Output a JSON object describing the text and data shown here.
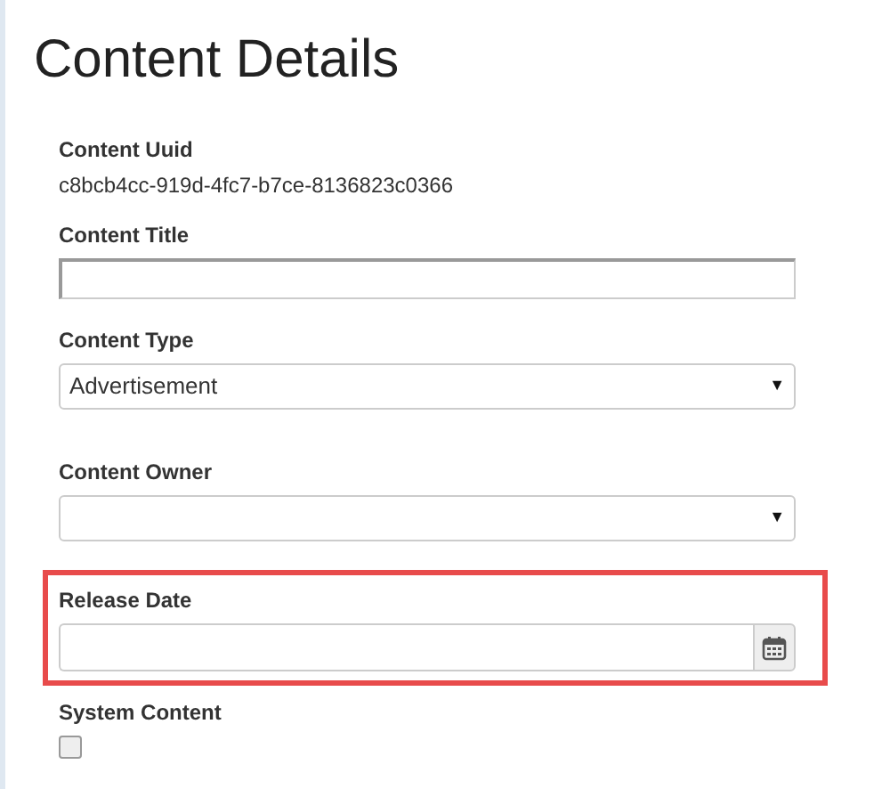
{
  "title": "Content Details",
  "fields": [
    {
      "kind": "text",
      "label": "Content Uuid",
      "value": "c8bcb4cc-919d-4fc7-b7ce-8136823c0366"
    },
    {
      "kind": "input",
      "label": "Content Title"
    },
    {
      "kind": "select",
      "label": "Content Type",
      "value": "Advertisement",
      "arrow": "▼"
    },
    {
      "kind": "select",
      "label": "Content Owner",
      "arrow": "▼"
    },
    {
      "kind": "date",
      "label": "Release Date",
      "highlighted": true
    },
    {
      "kind": "checkbox",
      "label": "System Content",
      "checked": false
    }
  ]
}
